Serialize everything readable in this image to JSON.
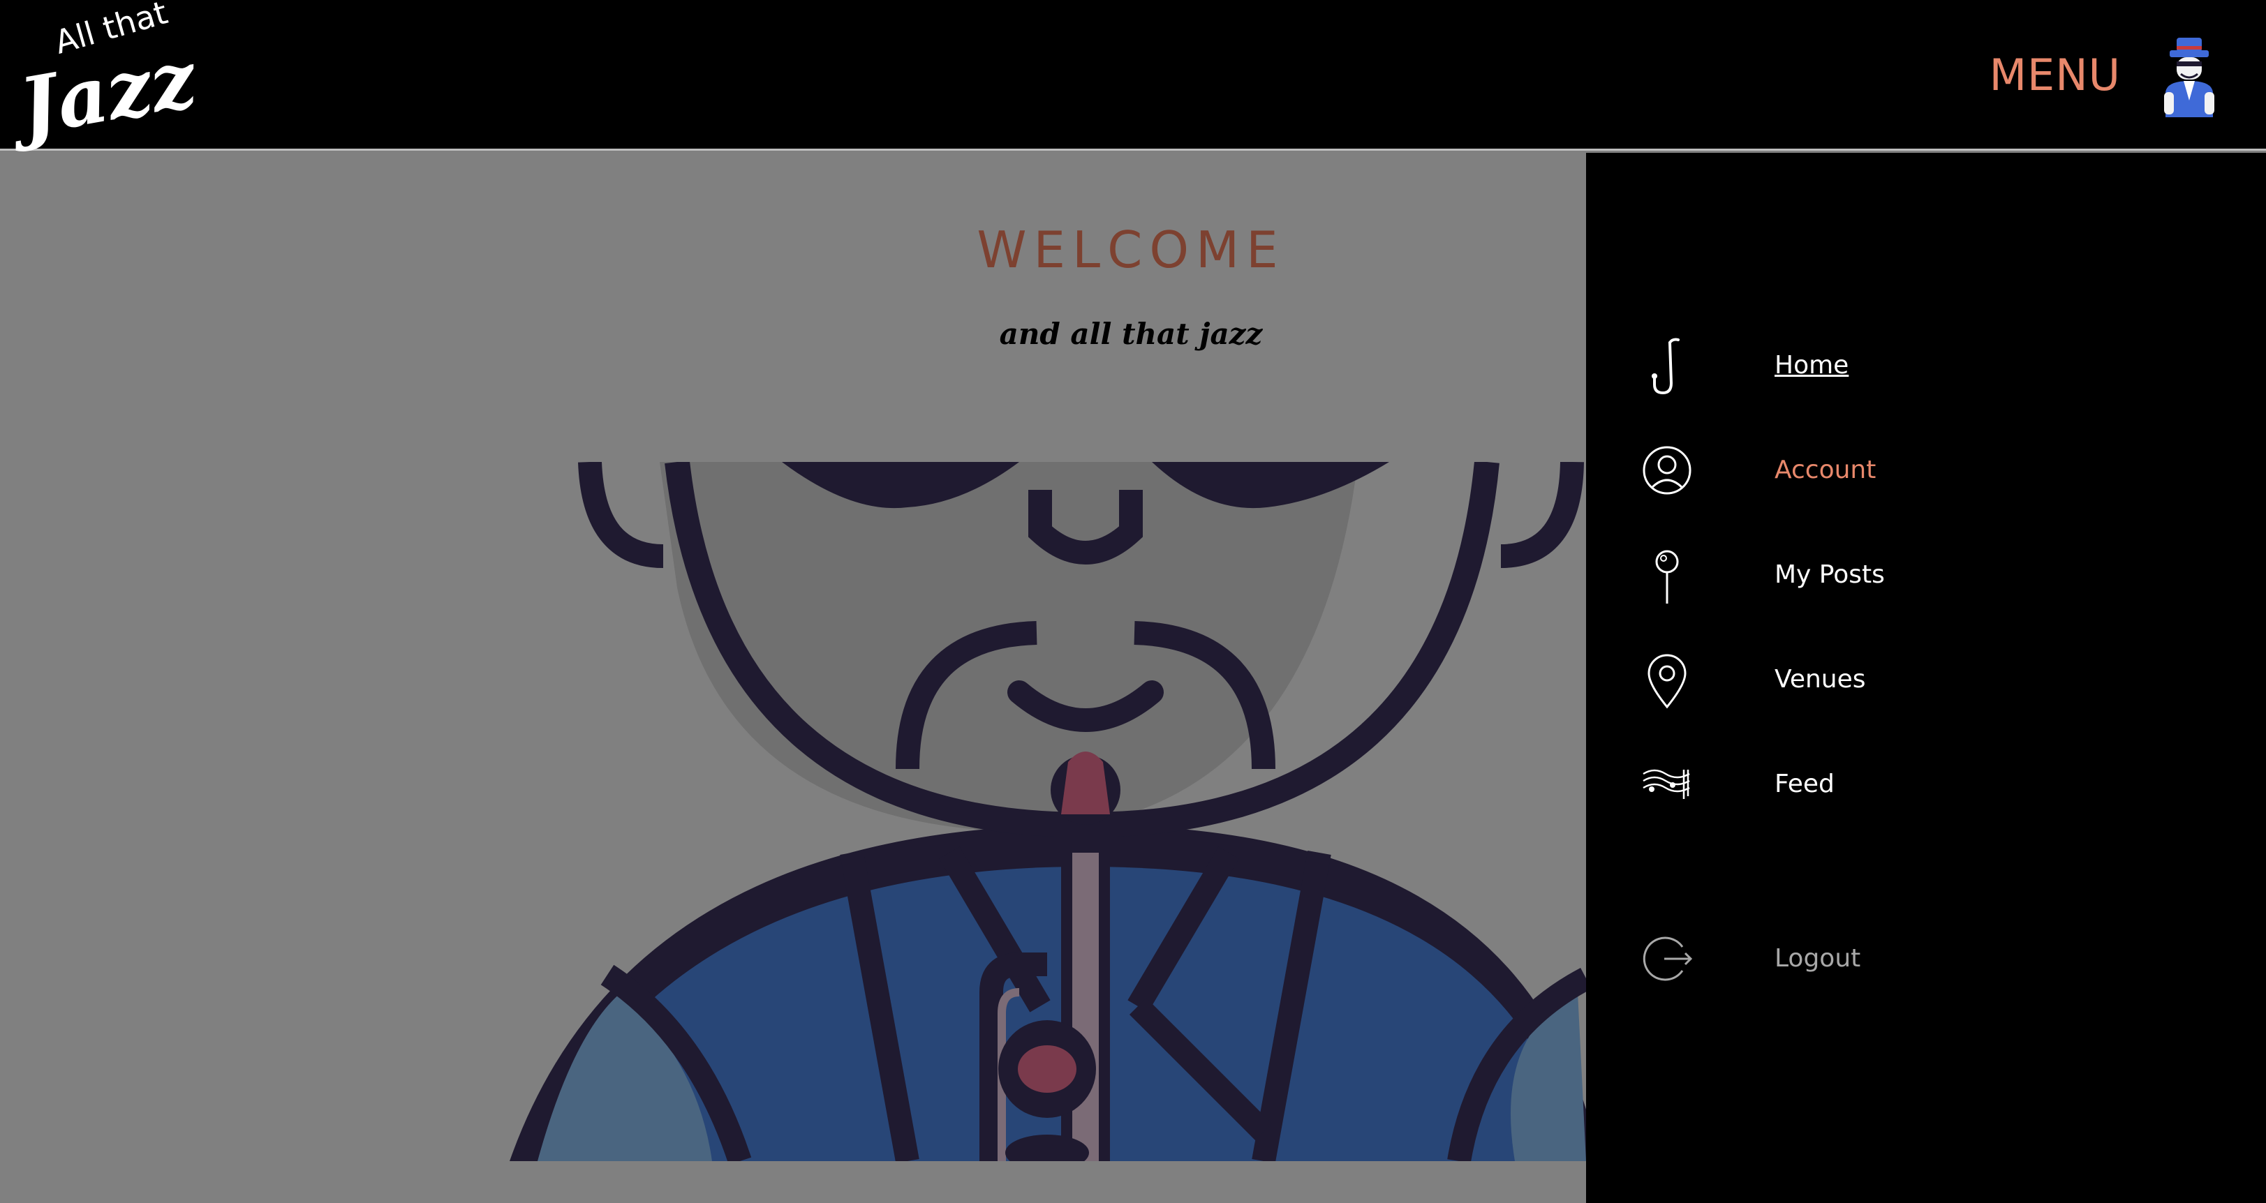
{
  "header": {
    "logo": {
      "line1": "All that",
      "line2": "Jazz"
    },
    "menu_label": "MENU",
    "avatar": "user-avatar-jazz-character"
  },
  "main": {
    "title": "WELCOME",
    "tagline": "and all that jazz",
    "hero": "saxophone-player-illustration"
  },
  "side_menu": {
    "items": [
      {
        "label": "Home",
        "icon": "saxophone-icon",
        "active": true
      },
      {
        "label": "Account",
        "icon": "user-circle-icon"
      },
      {
        "label": "My Posts",
        "icon": "pin-icon"
      },
      {
        "label": "Venues",
        "icon": "map-marker-icon"
      },
      {
        "label": "Feed",
        "icon": "music-sheet-icon"
      }
    ],
    "logout": {
      "label": "Logout",
      "icon": "logout-icon"
    }
  },
  "colors": {
    "accent": "#e8886b",
    "welcome": "#7d4130",
    "overlay_bg": "#808080",
    "header_bg": "#000000",
    "illustration_dark": "#1f1a30",
    "illustration_blue": "#284677"
  }
}
